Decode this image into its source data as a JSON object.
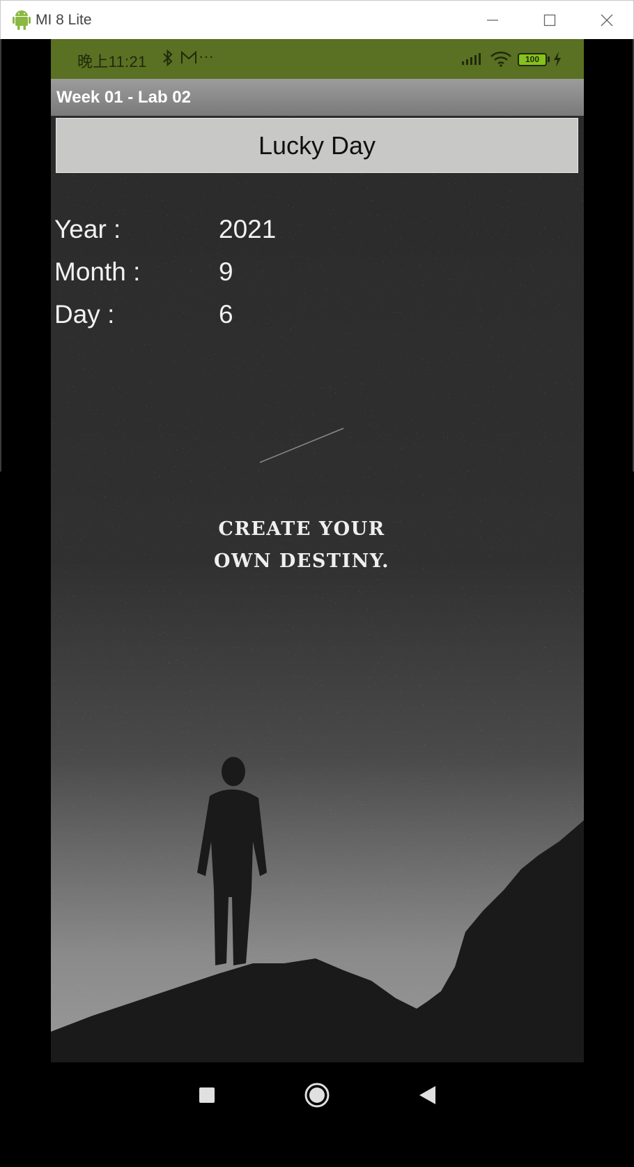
{
  "window": {
    "title": "MI 8 Lite"
  },
  "status_bar": {
    "time": "晚上11:21",
    "more": "···",
    "battery": "100"
  },
  "app": {
    "title": "Week 01 - Lab 02"
  },
  "main": {
    "button_label": "Lucky Day",
    "rows": [
      {
        "label": "Year :",
        "value": "2021"
      },
      {
        "label": "Month :",
        "value": "9"
      },
      {
        "label": "Day :",
        "value": "6"
      }
    ],
    "quote_line1": "CREATE YOUR",
    "quote_line2": "OWN DESTINY."
  },
  "icons": {
    "window": [
      "android-icon",
      "minimize-icon",
      "maximize-icon",
      "close-icon"
    ],
    "status": [
      "bluetooth-icon",
      "mail-icon",
      "signal-icon",
      "wifi-icon",
      "battery-icon",
      "charging-icon"
    ],
    "nav": [
      "recent-apps-icon",
      "home-icon",
      "back-icon"
    ]
  },
  "colors": {
    "status_bar": "#5a7022",
    "app_bar": "#8a8a8a",
    "button": "#c8c9c7",
    "battery_fill": "#86c11c"
  }
}
